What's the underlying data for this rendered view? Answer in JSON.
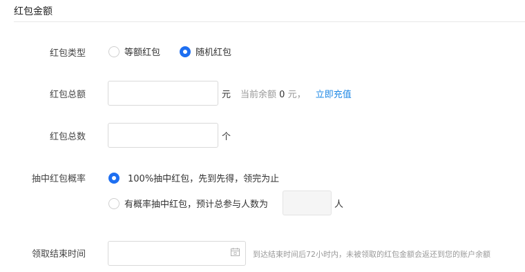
{
  "section": {
    "title": "红包金额"
  },
  "type_row": {
    "label": "红包类型",
    "options": [
      "等额红包",
      "随机红包"
    ],
    "selected": "随机红包"
  },
  "amount_row": {
    "label": "红包总额",
    "value": "",
    "unit": "元",
    "balance_prefix": "当前余额",
    "balance_value": "0",
    "balance_suffix": "元，",
    "recharge_link": "立即充值"
  },
  "count_row": {
    "label": "红包总数",
    "value": "",
    "unit": "个"
  },
  "probability_row": {
    "label": "抽中红包概率",
    "option_full": "100%抽中红包，先到先得，领完为止",
    "option_partial": "有概率抽中红包，预计总参与人数为",
    "partial_unit": "人",
    "selected": "100%抽中红包，先到先得，领完为止"
  },
  "end_time_row": {
    "label": "领取结束时间",
    "value": "",
    "hint": "到达结束时间后72小时内，未被领取的红包金额会返还到您的账户余额"
  },
  "colors": {
    "accent": "#1e6ff1",
    "link": "#1e88e5"
  }
}
